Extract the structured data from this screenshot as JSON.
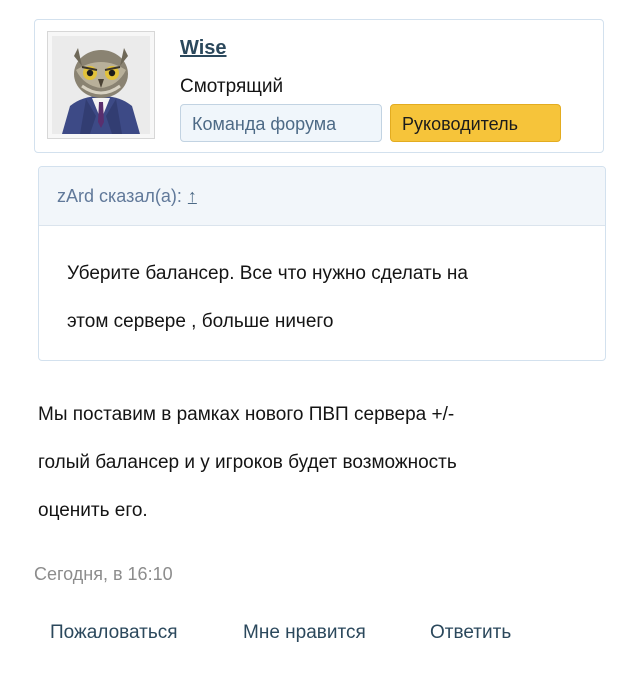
{
  "user": {
    "name": "Wise",
    "title": "Смотрящий",
    "banners": [
      "Команда форума",
      "Руководитель"
    ],
    "banner_colors": {
      "team_bg": "#f0f6fb",
      "lead_bg": "#f6c43a"
    }
  },
  "quote": {
    "author_line": "zArd сказал(а):",
    "jump_icon": "↑",
    "lines": [
      "Уберите балансер. Все что нужно сделать на",
      "этом сервере , больше ничего"
    ]
  },
  "message": {
    "lines": [
      "Мы поставим в рамках нового ПВП сервера +/-",
      "голый балансер и у игроков будет возможность",
      "оценить его."
    ]
  },
  "meta": {
    "date": "Сегодня, в 16:10"
  },
  "actions": {
    "report": "Пожаловаться",
    "like": "Мне нравится",
    "reply": "Ответить"
  },
  "colors": {
    "link": "#2b485c",
    "border": "#d3e1ee",
    "muted": "#8c8c8c"
  }
}
